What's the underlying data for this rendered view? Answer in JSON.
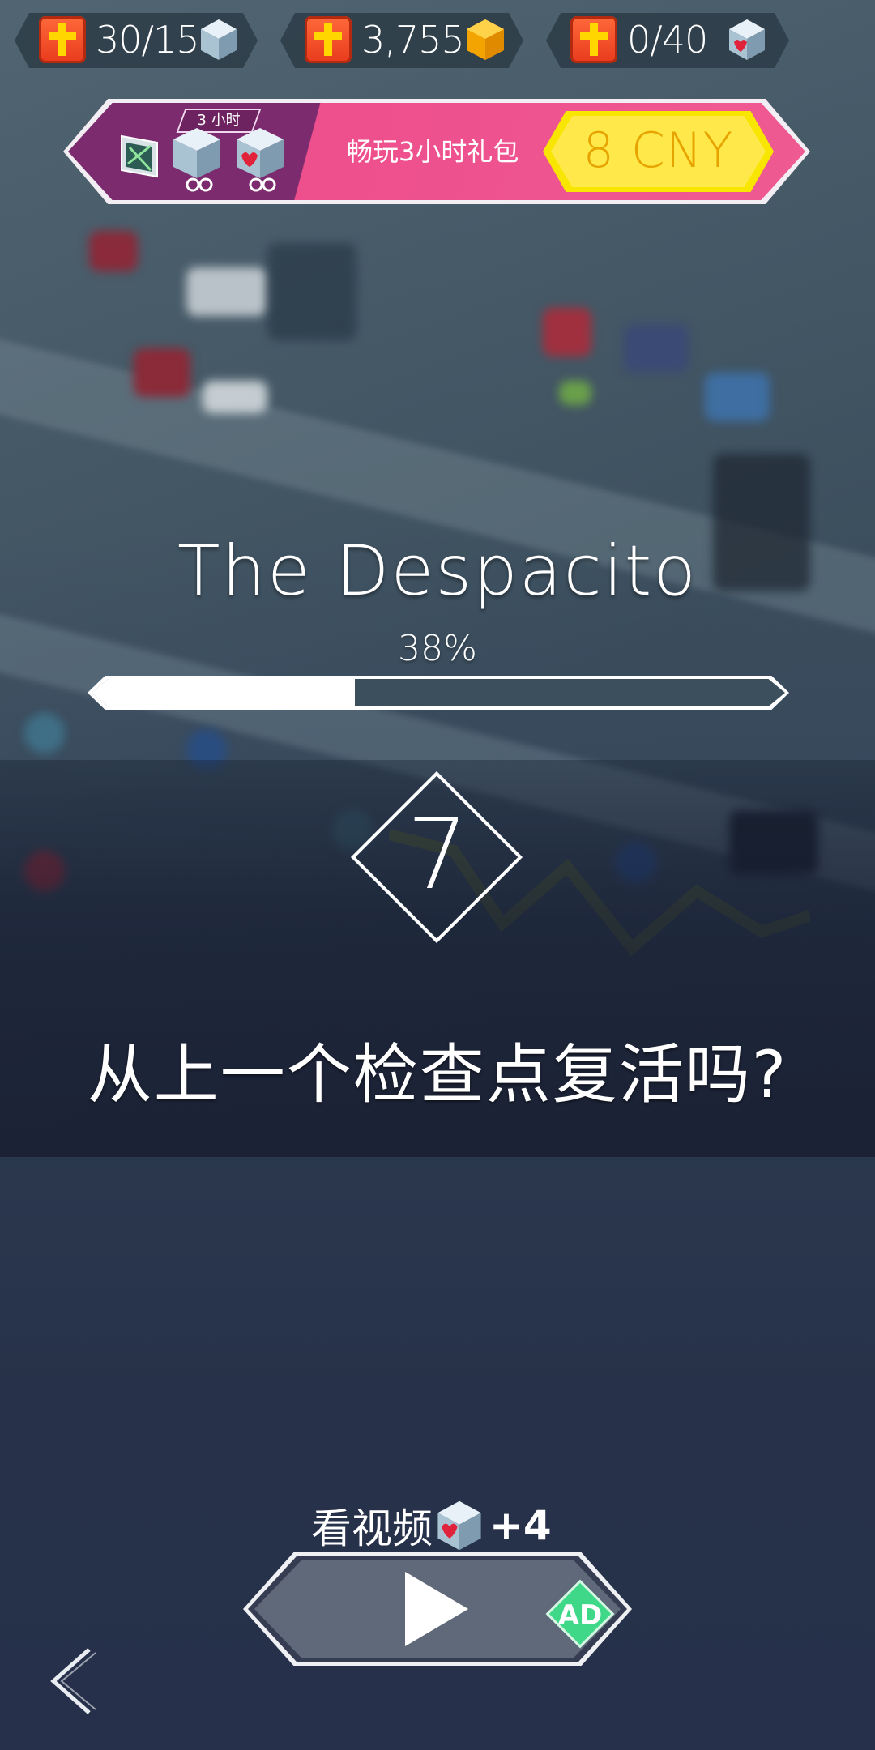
{
  "resources": [
    {
      "id": "lives-cubes",
      "value": "30/15"
    },
    {
      "id": "gems",
      "value": "3,755"
    },
    {
      "id": "heart-cubes",
      "value": "0/40"
    }
  ],
  "promo": {
    "tag": "3 小时",
    "label": "畅玩3小时礼包",
    "price": "8 CNY"
  },
  "song": {
    "title": "The Despacito",
    "progress_label": "38%",
    "progress": 0.38
  },
  "revive": {
    "countdown": "7",
    "question": "从上一个检查点复活吗?"
  },
  "video": {
    "label": "看视频",
    "reward": "+4",
    "ad_badge": "AD"
  },
  "colors": {
    "promo_left": "#7c2b6e",
    "promo_right": "#ef5a92",
    "price_yellow": "#ffe94a",
    "ad_green": "#3fd888",
    "badge_orange": "#e83a1d"
  }
}
